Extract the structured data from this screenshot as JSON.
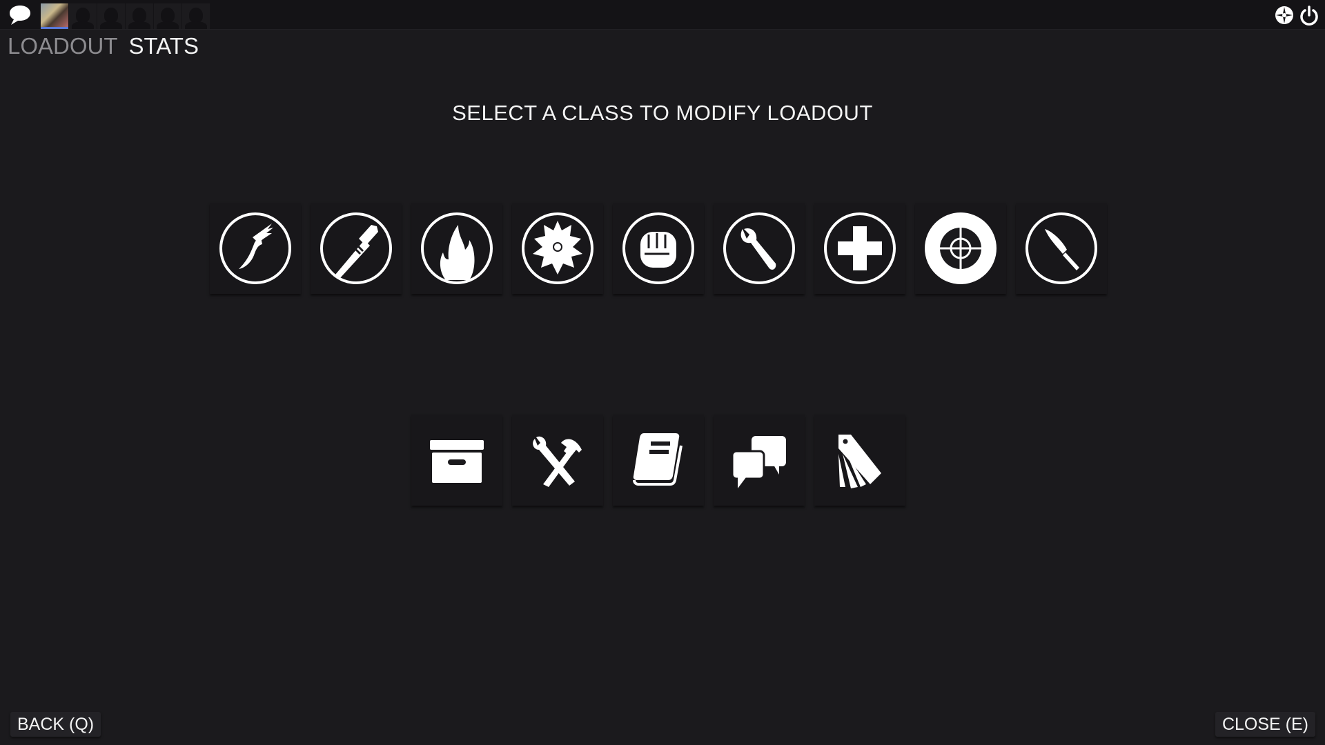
{
  "topbar": {
    "icons": [
      "chat-bubble-icon",
      "tf2-logo-icon",
      "power-icon"
    ],
    "friend_slots": 6
  },
  "tabs": [
    {
      "label": "LOADOUT",
      "active": false
    },
    {
      "label": "STATS",
      "active": true
    }
  ],
  "title": "SELECT A CLASS TO MODIFY LOADOUT",
  "classes": [
    "scout",
    "soldier",
    "pyro",
    "demoman",
    "heavy",
    "engineer",
    "medic",
    "sniper",
    "spy"
  ],
  "utilities": [
    "backpack",
    "crafting",
    "catalog",
    "trade",
    "tags"
  ],
  "buttons": {
    "back": "BACK (Q)",
    "close": "CLOSE (E)"
  }
}
